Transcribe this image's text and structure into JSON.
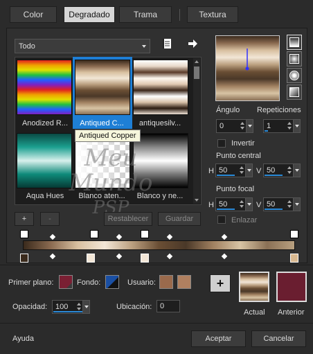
{
  "tabs": {
    "color": "Color",
    "gradient": "Degradado",
    "pattern": "Trama",
    "texture": "Textura"
  },
  "category": {
    "selected": "Todo"
  },
  "gradients": [
    {
      "label": "Anodized R..."
    },
    {
      "label": "Antiqued C..."
    },
    {
      "label": "antiquesilv..."
    },
    {
      "label": "Aqua Hues"
    },
    {
      "label": "Blanco aten..."
    },
    {
      "label": "Blanco y ne..."
    }
  ],
  "tooltip": "Antiqued Copper",
  "angle": {
    "label": "Ángulo",
    "value": "0"
  },
  "repeats": {
    "label": "Repeticiones",
    "value": "1"
  },
  "invert": {
    "label": "Invertir"
  },
  "center_point": {
    "label": "Punto central",
    "h_label": "H",
    "h_value": "50",
    "v_label": "V",
    "v_value": "50"
  },
  "focal_point": {
    "label": "Punto focal",
    "h_label": "H",
    "h_value": "50",
    "v_label": "V",
    "v_value": "50"
  },
  "link": {
    "label": "Enlazar"
  },
  "buttons": {
    "add": "+",
    "remove": "-",
    "reset": "Restablecer",
    "save": "Guardar"
  },
  "foreground": {
    "label": "Primer plano:",
    "color": "#7a1f33"
  },
  "background": {
    "label": "Fondo:",
    "color": "#1a4fa3"
  },
  "user": {
    "label": "Usuario:",
    "color1": "#9a6a4c",
    "color2": "#b08060"
  },
  "opacity": {
    "label": "Opacidad:",
    "value": "100"
  },
  "location": {
    "label": "Ubicación:",
    "value": "0"
  },
  "current": {
    "label": "Actual"
  },
  "previous": {
    "label": "Anterior",
    "color": "#6a1e30"
  },
  "add_swatch": "+",
  "footer": {
    "help": "Ayuda",
    "accept": "Aceptar",
    "cancel": "Cancelar"
  },
  "watermark": {
    "line1": "Meu Mundo",
    "line2": "PSP"
  },
  "colors": {
    "accent": "#2a8ad8",
    "selection": "#1e7fd6"
  }
}
